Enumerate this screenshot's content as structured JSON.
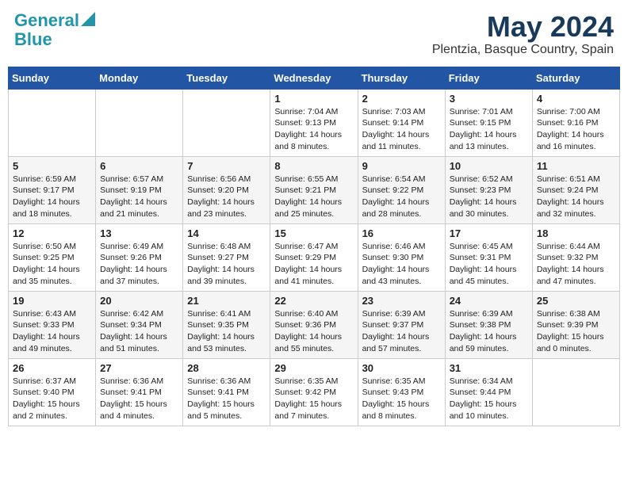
{
  "header": {
    "logo_general": "General",
    "logo_blue": "Blue",
    "month": "May 2024",
    "location": "Plentzia, Basque Country, Spain"
  },
  "days_of_week": [
    "Sunday",
    "Monday",
    "Tuesday",
    "Wednesday",
    "Thursday",
    "Friday",
    "Saturday"
  ],
  "weeks": [
    [
      {
        "day": "",
        "sunrise": "",
        "sunset": "",
        "daylight": ""
      },
      {
        "day": "",
        "sunrise": "",
        "sunset": "",
        "daylight": ""
      },
      {
        "day": "",
        "sunrise": "",
        "sunset": "",
        "daylight": ""
      },
      {
        "day": "1",
        "sunrise": "Sunrise: 7:04 AM",
        "sunset": "Sunset: 9:13 PM",
        "daylight": "Daylight: 14 hours and 8 minutes."
      },
      {
        "day": "2",
        "sunrise": "Sunrise: 7:03 AM",
        "sunset": "Sunset: 9:14 PM",
        "daylight": "Daylight: 14 hours and 11 minutes."
      },
      {
        "day": "3",
        "sunrise": "Sunrise: 7:01 AM",
        "sunset": "Sunset: 9:15 PM",
        "daylight": "Daylight: 14 hours and 13 minutes."
      },
      {
        "day": "4",
        "sunrise": "Sunrise: 7:00 AM",
        "sunset": "Sunset: 9:16 PM",
        "daylight": "Daylight: 14 hours and 16 minutes."
      }
    ],
    [
      {
        "day": "5",
        "sunrise": "Sunrise: 6:59 AM",
        "sunset": "Sunset: 9:17 PM",
        "daylight": "Daylight: 14 hours and 18 minutes."
      },
      {
        "day": "6",
        "sunrise": "Sunrise: 6:57 AM",
        "sunset": "Sunset: 9:19 PM",
        "daylight": "Daylight: 14 hours and 21 minutes."
      },
      {
        "day": "7",
        "sunrise": "Sunrise: 6:56 AM",
        "sunset": "Sunset: 9:20 PM",
        "daylight": "Daylight: 14 hours and 23 minutes."
      },
      {
        "day": "8",
        "sunrise": "Sunrise: 6:55 AM",
        "sunset": "Sunset: 9:21 PM",
        "daylight": "Daylight: 14 hours and 25 minutes."
      },
      {
        "day": "9",
        "sunrise": "Sunrise: 6:54 AM",
        "sunset": "Sunset: 9:22 PM",
        "daylight": "Daylight: 14 hours and 28 minutes."
      },
      {
        "day": "10",
        "sunrise": "Sunrise: 6:52 AM",
        "sunset": "Sunset: 9:23 PM",
        "daylight": "Daylight: 14 hours and 30 minutes."
      },
      {
        "day": "11",
        "sunrise": "Sunrise: 6:51 AM",
        "sunset": "Sunset: 9:24 PM",
        "daylight": "Daylight: 14 hours and 32 minutes."
      }
    ],
    [
      {
        "day": "12",
        "sunrise": "Sunrise: 6:50 AM",
        "sunset": "Sunset: 9:25 PM",
        "daylight": "Daylight: 14 hours and 35 minutes."
      },
      {
        "day": "13",
        "sunrise": "Sunrise: 6:49 AM",
        "sunset": "Sunset: 9:26 PM",
        "daylight": "Daylight: 14 hours and 37 minutes."
      },
      {
        "day": "14",
        "sunrise": "Sunrise: 6:48 AM",
        "sunset": "Sunset: 9:27 PM",
        "daylight": "Daylight: 14 hours and 39 minutes."
      },
      {
        "day": "15",
        "sunrise": "Sunrise: 6:47 AM",
        "sunset": "Sunset: 9:29 PM",
        "daylight": "Daylight: 14 hours and 41 minutes."
      },
      {
        "day": "16",
        "sunrise": "Sunrise: 6:46 AM",
        "sunset": "Sunset: 9:30 PM",
        "daylight": "Daylight: 14 hours and 43 minutes."
      },
      {
        "day": "17",
        "sunrise": "Sunrise: 6:45 AM",
        "sunset": "Sunset: 9:31 PM",
        "daylight": "Daylight: 14 hours and 45 minutes."
      },
      {
        "day": "18",
        "sunrise": "Sunrise: 6:44 AM",
        "sunset": "Sunset: 9:32 PM",
        "daylight": "Daylight: 14 hours and 47 minutes."
      }
    ],
    [
      {
        "day": "19",
        "sunrise": "Sunrise: 6:43 AM",
        "sunset": "Sunset: 9:33 PM",
        "daylight": "Daylight: 14 hours and 49 minutes."
      },
      {
        "day": "20",
        "sunrise": "Sunrise: 6:42 AM",
        "sunset": "Sunset: 9:34 PM",
        "daylight": "Daylight: 14 hours and 51 minutes."
      },
      {
        "day": "21",
        "sunrise": "Sunrise: 6:41 AM",
        "sunset": "Sunset: 9:35 PM",
        "daylight": "Daylight: 14 hours and 53 minutes."
      },
      {
        "day": "22",
        "sunrise": "Sunrise: 6:40 AM",
        "sunset": "Sunset: 9:36 PM",
        "daylight": "Daylight: 14 hours and 55 minutes."
      },
      {
        "day": "23",
        "sunrise": "Sunrise: 6:39 AM",
        "sunset": "Sunset: 9:37 PM",
        "daylight": "Daylight: 14 hours and 57 minutes."
      },
      {
        "day": "24",
        "sunrise": "Sunrise: 6:39 AM",
        "sunset": "Sunset: 9:38 PM",
        "daylight": "Daylight: 14 hours and 59 minutes."
      },
      {
        "day": "25",
        "sunrise": "Sunrise: 6:38 AM",
        "sunset": "Sunset: 9:39 PM",
        "daylight": "Daylight: 15 hours and 0 minutes."
      }
    ],
    [
      {
        "day": "26",
        "sunrise": "Sunrise: 6:37 AM",
        "sunset": "Sunset: 9:40 PM",
        "daylight": "Daylight: 15 hours and 2 minutes."
      },
      {
        "day": "27",
        "sunrise": "Sunrise: 6:36 AM",
        "sunset": "Sunset: 9:41 PM",
        "daylight": "Daylight: 15 hours and 4 minutes."
      },
      {
        "day": "28",
        "sunrise": "Sunrise: 6:36 AM",
        "sunset": "Sunset: 9:41 PM",
        "daylight": "Daylight: 15 hours and 5 minutes."
      },
      {
        "day": "29",
        "sunrise": "Sunrise: 6:35 AM",
        "sunset": "Sunset: 9:42 PM",
        "daylight": "Daylight: 15 hours and 7 minutes."
      },
      {
        "day": "30",
        "sunrise": "Sunrise: 6:35 AM",
        "sunset": "Sunset: 9:43 PM",
        "daylight": "Daylight: 15 hours and 8 minutes."
      },
      {
        "day": "31",
        "sunrise": "Sunrise: 6:34 AM",
        "sunset": "Sunset: 9:44 PM",
        "daylight": "Daylight: 15 hours and 10 minutes."
      },
      {
        "day": "",
        "sunrise": "",
        "sunset": "",
        "daylight": ""
      }
    ]
  ]
}
